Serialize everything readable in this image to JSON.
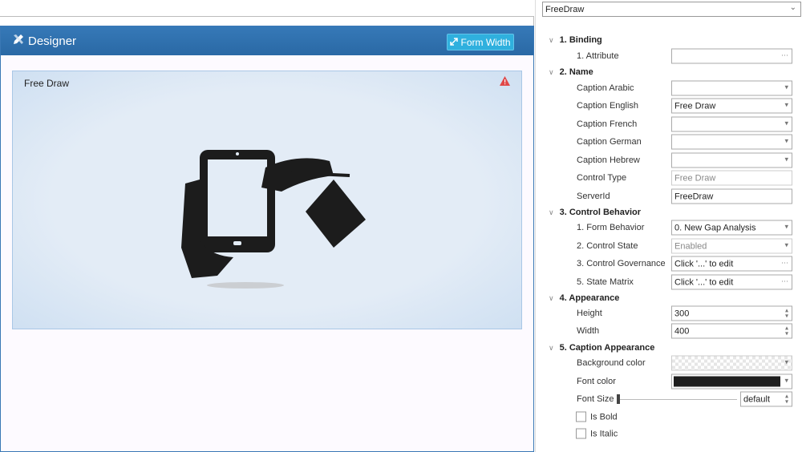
{
  "designer": {
    "title": "Designer",
    "form_width_label": "Form Width",
    "control_caption": "Free Draw"
  },
  "object_selector": {
    "value": "FreeDraw"
  },
  "properties": {
    "sections": [
      {
        "title": "1. Binding"
      },
      {
        "title": "2. Name"
      },
      {
        "title": "3. Control Behavior"
      },
      {
        "title": "4. Appearance"
      },
      {
        "title": "5. Caption Appearance"
      }
    ],
    "rows": [
      {
        "label": "1. Attribute",
        "value": "",
        "kind": "ellipsis"
      },
      {
        "label": "Caption Arabic",
        "value": "",
        "kind": "dropdown"
      },
      {
        "label": "Caption English",
        "value": "Free Draw",
        "kind": "dropdown"
      },
      {
        "label": "Caption French",
        "value": "",
        "kind": "dropdown"
      },
      {
        "label": "Caption German",
        "value": "",
        "kind": "dropdown"
      },
      {
        "label": "Caption Hebrew",
        "value": "",
        "kind": "dropdown"
      },
      {
        "label": "Control Type",
        "value": "Free Draw",
        "kind": "readonly"
      },
      {
        "label": "ServerId",
        "value": "FreeDraw",
        "kind": "text"
      },
      {
        "label": "1. Form Behavior",
        "value": "0. New Gap Analysis",
        "kind": "dropdown"
      },
      {
        "label": "2. Control State",
        "value": "Enabled",
        "kind": "dropdown-disabled"
      },
      {
        "label": "3. Control Governance",
        "value": "Click '...' to edit",
        "kind": "ellipsis"
      },
      {
        "label": "5. State Matrix",
        "value": "Click '...' to edit",
        "kind": "ellipsis"
      },
      {
        "label": "Height",
        "value": "300",
        "kind": "spinner"
      },
      {
        "label": "Width",
        "value": "400",
        "kind": "spinner"
      },
      {
        "label": "Background color",
        "value": "",
        "kind": "color-transparent"
      },
      {
        "label": "Font color",
        "value": "",
        "kind": "color-black"
      }
    ],
    "font_size": {
      "label": "Font Size",
      "value": "default",
      "slider_fraction": 0
    },
    "checkboxes": [
      {
        "label": "Is Bold",
        "checked": false
      },
      {
        "label": "Is Italic",
        "checked": false
      }
    ]
  },
  "colors": {
    "header_blue": "#2f72b0",
    "button_cyan": "#2fb0de",
    "warning_red": "#e04848",
    "font_color": "#1e1e1e"
  }
}
